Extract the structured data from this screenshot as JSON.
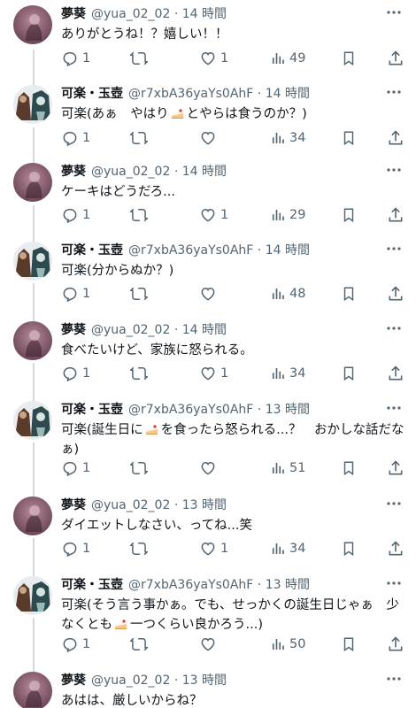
{
  "users": {
    "yua": {
      "name": "夢葵",
      "handle": "@yua_02_02"
    },
    "kara": {
      "name": "可楽・玉壺",
      "handle": "@r7xbA36yaYs0AhF"
    }
  },
  "tweets": [
    {
      "user": "yua",
      "time": "14 時間",
      "text": [
        "ありがとうね！？嬉しい！！"
      ],
      "replies": "1",
      "retweets": "",
      "likes": "1",
      "views": "49"
    },
    {
      "user": "kara",
      "time": "14 時間",
      "text": [
        "可楽(あぁ　やはり",
        "とやらは食うのか？)"
      ],
      "replies": "1",
      "retweets": "",
      "likes": "",
      "views": "34"
    },
    {
      "user": "yua",
      "time": "14 時間",
      "text": [
        "ケーキはどうだろ..."
      ],
      "replies": "1",
      "retweets": "",
      "likes": "1",
      "views": "29"
    },
    {
      "user": "kara",
      "time": "14 時間",
      "text": [
        "可楽(分からぬか？)"
      ],
      "replies": "1",
      "retweets": "",
      "likes": "",
      "views": "48"
    },
    {
      "user": "yua",
      "time": "14 時間",
      "text": [
        "食べたいけど、家族に怒られる。"
      ],
      "replies": "1",
      "retweets": "",
      "likes": "1",
      "views": "34"
    },
    {
      "user": "kara",
      "time": "13 時間",
      "text": [
        "可楽(誕生日に",
        "を食ったら怒られる...？　おかしな話だな",
        "ぁ)"
      ],
      "replies": "1",
      "retweets": "",
      "likes": "",
      "views": "51"
    },
    {
      "user": "yua",
      "time": "13 時間",
      "text": [
        "ダイエットしなさい、ってね...笑"
      ],
      "replies": "1",
      "retweets": "",
      "likes": "1",
      "views": "34"
    },
    {
      "user": "kara",
      "time": "13 時間",
      "text": [
        "可楽(そう言う事かぁ。でも、せっかくの誕生日じゃぁ　少",
        "なくとも",
        "一つくらい良かろう...)"
      ],
      "replies": "1",
      "retweets": "",
      "likes": "",
      "views": "50"
    },
    {
      "user": "yua",
      "time": "13 時間",
      "text": [
        "あはは、厳しいからね？"
      ],
      "replies": "",
      "retweets": "",
      "likes": "",
      "views": ""
    }
  ],
  "icons": {
    "reply": "reply-icon",
    "retweet": "retweet-icon",
    "like": "heart-icon",
    "views": "analytics-icon",
    "bookmark": "bookmark-icon",
    "share": "share-icon",
    "more": "more-icon",
    "cake": "cake-emoji"
  },
  "colors": {
    "text": "#0f1419",
    "muted": "#536471",
    "thread_line": "#cfd9de",
    "background": "#ffffff"
  }
}
